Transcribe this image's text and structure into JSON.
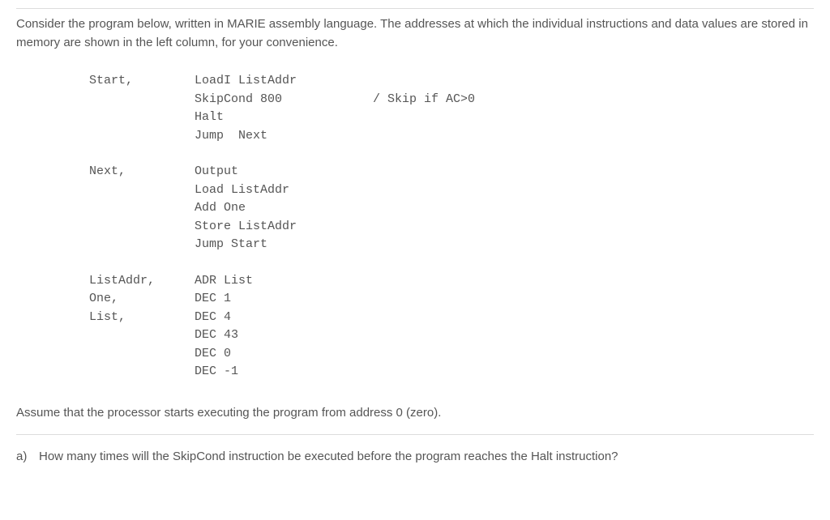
{
  "intro": "Consider the program below, written in MARIE assembly language. The addresses at which the individual instructions and data values are stored in memory are shown in the left column, for your convenience.",
  "code": {
    "sections": [
      {
        "lines": [
          {
            "label": "Start,",
            "instr": "LoadI ListAddr",
            "comment": ""
          },
          {
            "label": "",
            "instr": "SkipCond 800",
            "comment": "/ Skip if AC>0"
          },
          {
            "label": "",
            "instr": "Halt",
            "comment": ""
          },
          {
            "label": "",
            "instr": "Jump  Next",
            "comment": ""
          }
        ]
      },
      {
        "lines": [
          {
            "label": "Next,",
            "instr": "Output",
            "comment": ""
          },
          {
            "label": "",
            "instr": "Load ListAddr",
            "comment": ""
          },
          {
            "label": "",
            "instr": "Add One",
            "comment": ""
          },
          {
            "label": "",
            "instr": "Store ListAddr",
            "comment": ""
          },
          {
            "label": "",
            "instr": "Jump Start",
            "comment": ""
          }
        ]
      },
      {
        "lines": [
          {
            "label": "ListAddr,",
            "instr": "ADR List",
            "comment": ""
          },
          {
            "label": "One,",
            "instr": "DEC 1",
            "comment": ""
          },
          {
            "label": "List,",
            "instr": "DEC 4",
            "comment": ""
          },
          {
            "label": "",
            "instr": "DEC 43",
            "comment": ""
          },
          {
            "label": "",
            "instr": "DEC 0",
            "comment": ""
          },
          {
            "label": "",
            "instr": "DEC -1",
            "comment": ""
          }
        ]
      }
    ]
  },
  "assume": "Assume that the processor starts executing the program from address 0 (zero).",
  "question": {
    "label": "a)",
    "text": "How many times will the SkipCond instruction be executed before the program reaches the Halt instruction?"
  }
}
